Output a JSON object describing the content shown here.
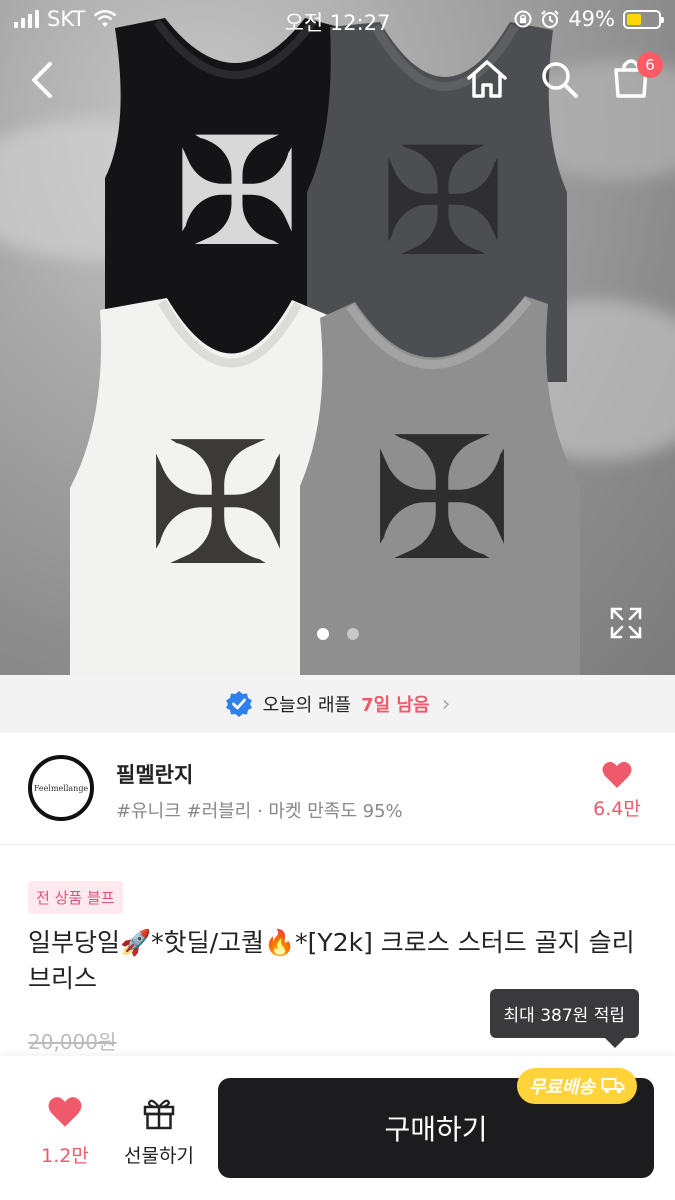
{
  "status_bar": {
    "carrier": "SKT",
    "time": "오전 12:27",
    "battery": "49%",
    "battery_level": 0.49
  },
  "nav": {
    "back_icon": "chevron-left-icon",
    "home_icon": "home-icon",
    "search_icon": "search-icon",
    "cart_icon": "shopping-bag-icon",
    "cart_count": "6"
  },
  "gallery": {
    "pages": 2,
    "current_page": 1
  },
  "raffle_banner": {
    "label": "오늘의 래플",
    "remaining": "7일 남음"
  },
  "shop": {
    "logo_text": "Feelmellange",
    "name": "필멜란지",
    "subtitle": "#유니크 #러블리 · 마켓 만족도 95%",
    "likes": "6.4만"
  },
  "product": {
    "tag": "전 상품 블프",
    "title": "일부당일🚀*핫딜/고퀄🔥*[Y2k] 크로스 스터드 골지 슬리브리스",
    "original_price": "20,000원",
    "points_tooltip": "최대 387원 적립"
  },
  "bottom_bar": {
    "likes": "1.2만",
    "gift_label": "선물하기",
    "buy_label": "구매하기",
    "shipping_badge": "무료배송"
  },
  "colors": {
    "accent_pink": "#ef5a6b",
    "buy_button": "#1c1c1e",
    "shipping_badge": "#ffd339",
    "verified_blue": "#2f80ed"
  }
}
